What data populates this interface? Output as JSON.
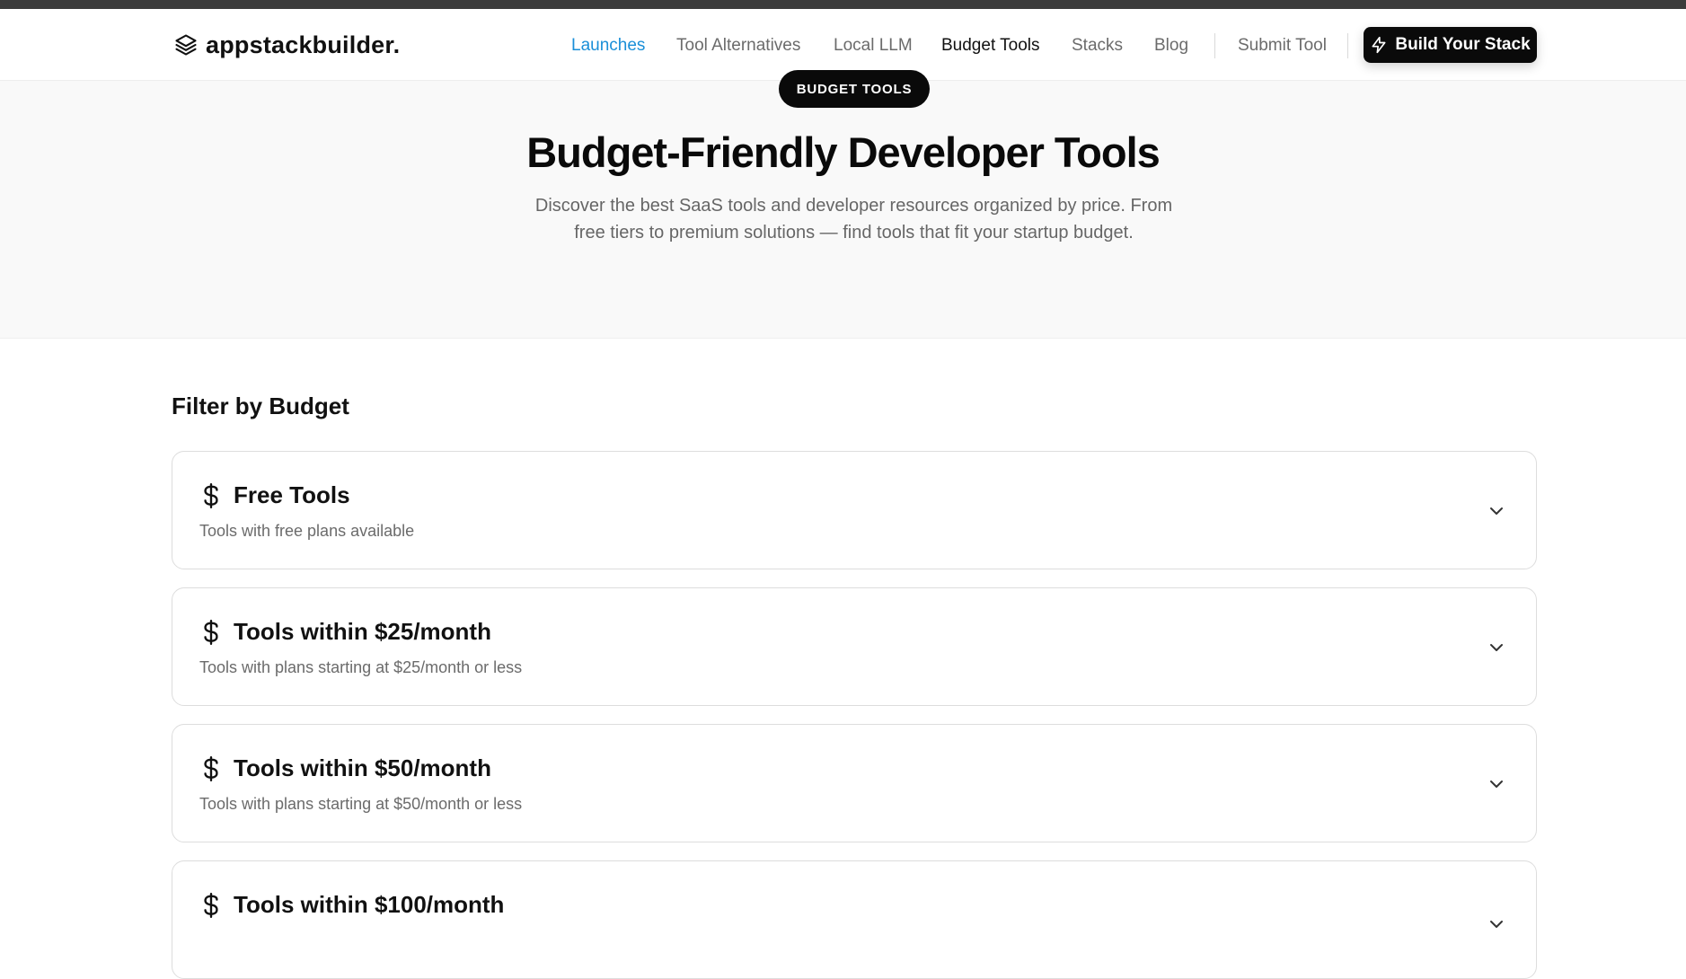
{
  "brand": {
    "name": "appstackbuilder."
  },
  "nav": {
    "items": [
      {
        "label": "Launches"
      },
      {
        "label": "Tool Alternatives"
      },
      {
        "label": "Local LLM"
      },
      {
        "label": "Budget Tools"
      },
      {
        "label": "Stacks"
      },
      {
        "label": "Blog"
      },
      {
        "label": "Submit Tool"
      }
    ],
    "cta_label": "Build Your Stack"
  },
  "hero": {
    "badge": "BUDGET TOOLS",
    "title": "Budget-Friendly Developer Tools",
    "description": "Discover the best SaaS tools and developer resources organized by price. From free tiers to premium solutions — find tools that fit your startup budget."
  },
  "filter": {
    "heading": "Filter by Budget",
    "cards": [
      {
        "title": "Free Tools",
        "subtitle": "Tools with free plans available",
        "icon": "dollar-icon"
      },
      {
        "title": "Tools within $25/month",
        "subtitle": "Tools with plans starting at $25/month or less",
        "icon": "dollar-icon"
      },
      {
        "title": "Tools within $50/month",
        "subtitle": "Tools with plans starting at $50/month or less",
        "icon": "dollar-icon"
      },
      {
        "title": "Tools within $100/month",
        "subtitle": "",
        "icon": "dollar-icon"
      }
    ]
  },
  "colors": {
    "accent_link": "#1a8fd8",
    "cta_background": "#0a0a0a",
    "hero_background": "#f9f9f9"
  }
}
